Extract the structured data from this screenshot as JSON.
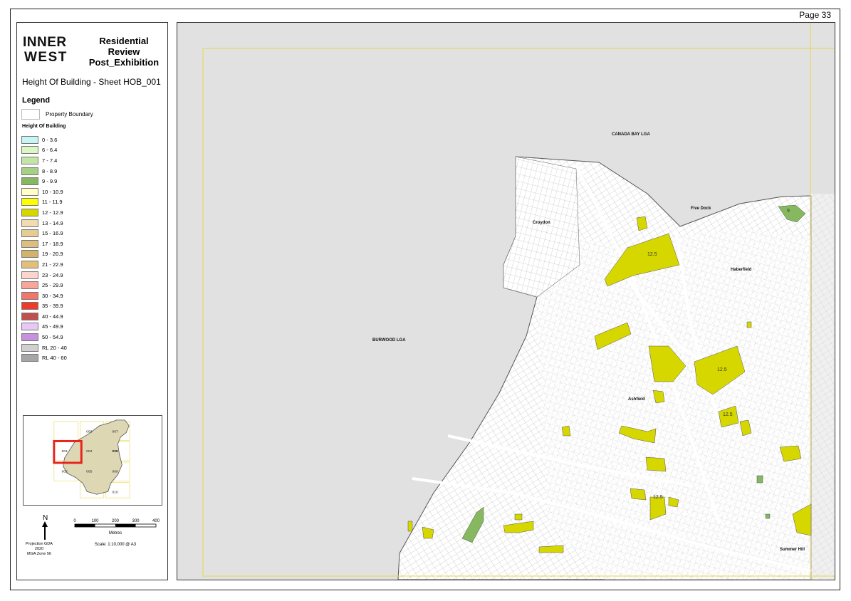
{
  "page": {
    "number_label": "Page 33"
  },
  "panel": {
    "logo_line1": "INNER",
    "logo_line2": "WEST",
    "report_title_line1": "Residential",
    "report_title_line2": "Review",
    "report_title_line3": "Post_Exhibition",
    "sheet_title": "Height Of Building - Sheet HOB_001",
    "legend_title": "Legend",
    "property_boundary_label": "Property Boundary",
    "hob_title": "Height Of Building"
  },
  "legend_items": [
    {
      "label": "0 - 3.6",
      "color": "#c6f5f5"
    },
    {
      "label": "6 - 6.4",
      "color": "#dcf7c4"
    },
    {
      "label": "7 - 7.4",
      "color": "#c3e6a7"
    },
    {
      "label": "8 - 8.9",
      "color": "#a6d184"
    },
    {
      "label": "9 - 9.9",
      "color": "#86b860"
    },
    {
      "label": "10 - 10.9",
      "color": "#ffffc6"
    },
    {
      "label": "11 - 11.9",
      "color": "#ffff00"
    },
    {
      "label": "12 - 12.9",
      "color": "#d7d700"
    },
    {
      "label": "13 - 14.9",
      "color": "#f0dcb0"
    },
    {
      "label": "15 - 16.9",
      "color": "#e6cd94"
    },
    {
      "label": "17 - 18.9",
      "color": "#dcbf80"
    },
    {
      "label": "19 - 20.9",
      "color": "#d3b26a"
    },
    {
      "label": "21 - 22.9",
      "color": "#e3c07a"
    },
    {
      "label": "23 - 24.9",
      "color": "#fcd5cf"
    },
    {
      "label": "25 - 29.9",
      "color": "#f8a59a"
    },
    {
      "label": "30 - 34.9",
      "color": "#f3766a"
    },
    {
      "label": "35 - 39.9",
      "color": "#ef3b2c"
    },
    {
      "label": "40 - 44.9",
      "color": "#c0504d"
    },
    {
      "label": "45 - 49.9",
      "color": "#e8c8f5"
    },
    {
      "label": "50 - 54.9",
      "color": "#c891e0"
    },
    {
      "label": "RL 20 - 40",
      "color": "#d0d0d0"
    },
    {
      "label": "RL 40 - 60",
      "color": "#a6a6a6"
    }
  ],
  "keymap": {
    "sheets": [
      "001",
      "002",
      "003",
      "004",
      "005",
      "006",
      "007",
      "008",
      "009",
      "010"
    ],
    "highlight_color": "#e8231b"
  },
  "north": {
    "label": "N"
  },
  "projection": {
    "line1": "Projection GDA 2020",
    "line2": "MGA Zone 56"
  },
  "scale": {
    "ticks": [
      "0",
      "100",
      "200",
      "300",
      "400"
    ],
    "unit": "Metres",
    "text": "Scale: 1:10,000 @ A3"
  },
  "map": {
    "labels": {
      "canada_bay": "CANADA BAY LGA",
      "burwood": "BURWOOD LGA",
      "croydon": "Croydon",
      "five_dock": "Five Dock",
      "haberfield": "Haberfield",
      "ashfield": "Ashfield",
      "summer_hill": "Summer Hill"
    },
    "height_labels": [
      "12.5",
      "12.5",
      "12.5",
      "12.5",
      "9"
    ],
    "colors": {
      "outside": "#e1e1e1",
      "lga_land": "#ffffff",
      "parcel_line": "#9a9a9a",
      "yellow": "#d7d700",
      "green": "#86b860",
      "frame": "#e6d84a"
    }
  }
}
